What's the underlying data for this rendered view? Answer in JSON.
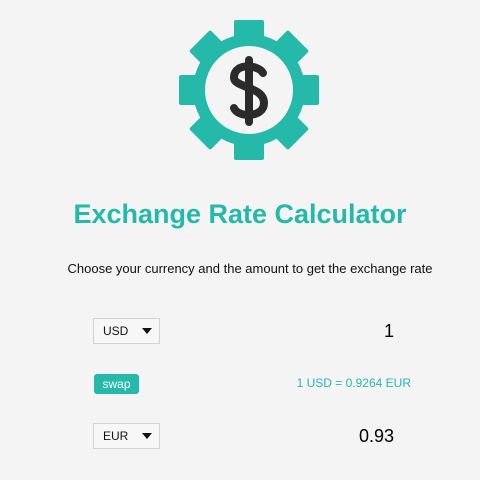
{
  "app": {
    "title": "Exchange Rate Calculator",
    "subtitle": "Choose your currency and the amount to get the exchange rate",
    "logo_icon": "gear-dollar-icon"
  },
  "from": {
    "currency": "USD",
    "amount": "1"
  },
  "swap": {
    "label": "swap"
  },
  "rate": {
    "text": "1 USD = 0.9264 EUR"
  },
  "to": {
    "currency": "EUR",
    "amount": "0.93"
  },
  "colors": {
    "accent": "#24b9a9",
    "background": "#f4f4f4",
    "icon_dark": "#2b2b2b"
  }
}
